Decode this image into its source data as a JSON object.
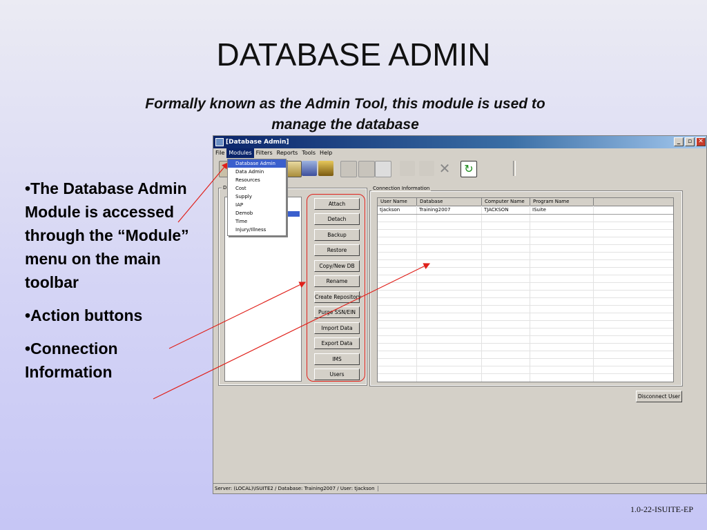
{
  "slide": {
    "title": "DATABASE ADMIN",
    "subtitle": "Formally known as the Admin Tool, this module is used to manage the database",
    "bullets": [
      "•The Database Admin Module is accessed through the “Module” menu on the main toolbar",
      "•Action buttons",
      "•Connection Information"
    ],
    "footer": "1.0-22-ISUITE-EP"
  },
  "window": {
    "title": "[Database Admin]",
    "menu": [
      "File",
      "Modules",
      "Filters",
      "Reports",
      "Tools",
      "Help"
    ],
    "active_menu": "Modules",
    "modules_menu_items": [
      "Database Admin",
      "Data Admin",
      "Resources",
      "Cost",
      "Supply",
      "IAP",
      "Demob",
      "Time",
      "Injury/Illness"
    ],
    "left_group_label": "D",
    "connection_group_label": "Connection Information",
    "action_buttons": [
      "Attach",
      "Detach",
      "Backup",
      "Restore",
      "Copy/New DB",
      "Rename",
      "Create Repository",
      "Purge SSN/EIN",
      "Import Data",
      "Export Data",
      "IMS",
      "Users"
    ],
    "grid": {
      "columns": [
        "User Name",
        "Database",
        "Computer Name",
        "Program Name"
      ],
      "rows": [
        [
          "tjackson",
          "Training2007",
          "TJACKSON",
          "ISuite"
        ]
      ]
    },
    "disconnect_button": "Disconnect User",
    "status": "Server: (LOCAL)\\ISUITE2  /  Database: Training2007  /  User: tjackson"
  },
  "colors": {
    "annotation": "#e0201a",
    "titlebar": "#0a246a"
  },
  "icons": [
    "app-icon",
    "minimize-icon",
    "maximize-icon",
    "close-icon",
    "clipboard-icon",
    "fire-truck-icon",
    "briefcase-icon",
    "calculator-icon",
    "printer-icon",
    "preview-icon",
    "move-icon",
    "pen-icon",
    "delete-icon",
    "refresh-icon"
  ]
}
